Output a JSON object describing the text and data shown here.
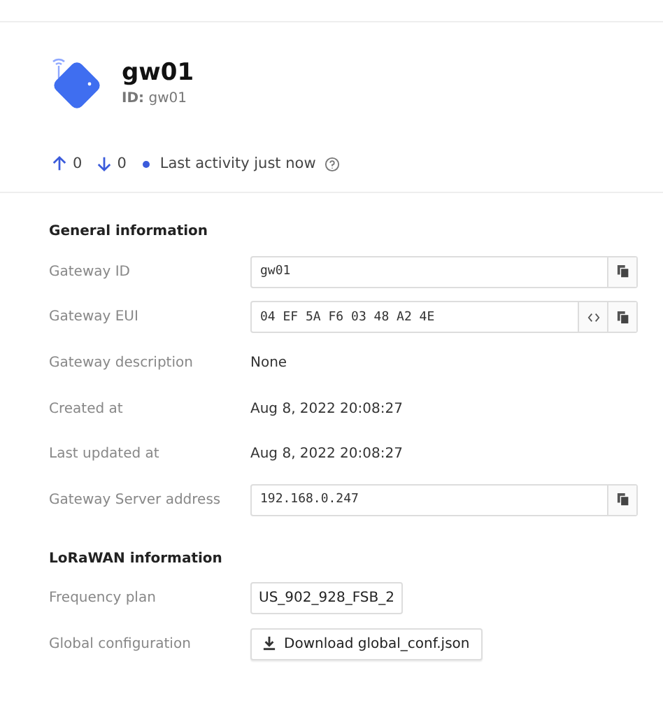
{
  "gateway": {
    "name": "gw01",
    "id_label": "ID:",
    "id": "gw01"
  },
  "stats": {
    "uplink": "0",
    "downlink": "0",
    "online": true,
    "activity": "Last activity just now"
  },
  "sections": [
    {
      "title": "General information",
      "rows": [
        {
          "label": "Gateway ID",
          "kind": "copyable",
          "value": "gw01"
        },
        {
          "label": "Gateway EUI",
          "kind": "hex",
          "value": "04 EF 5A F6 03 48 A2 4E"
        },
        {
          "label": "Gateway description",
          "kind": "text",
          "value": "None"
        },
        {
          "label": "Created at",
          "kind": "text",
          "value": "Aug 8, 2022 20:08:27"
        },
        {
          "label": "Last updated at",
          "kind": "text",
          "value": "Aug 8, 2022 20:08:27"
        },
        {
          "label": "Gateway Server address",
          "kind": "copyable",
          "value": "192.168.0.247"
        }
      ]
    },
    {
      "title": "LoRaWAN information",
      "rows": [
        {
          "label": "Frequency plan",
          "kind": "tag",
          "value": "US_902_928_FSB_2"
        },
        {
          "label": "Global configuration",
          "kind": "download",
          "value": "Download global_conf.json"
        }
      ]
    }
  ]
}
